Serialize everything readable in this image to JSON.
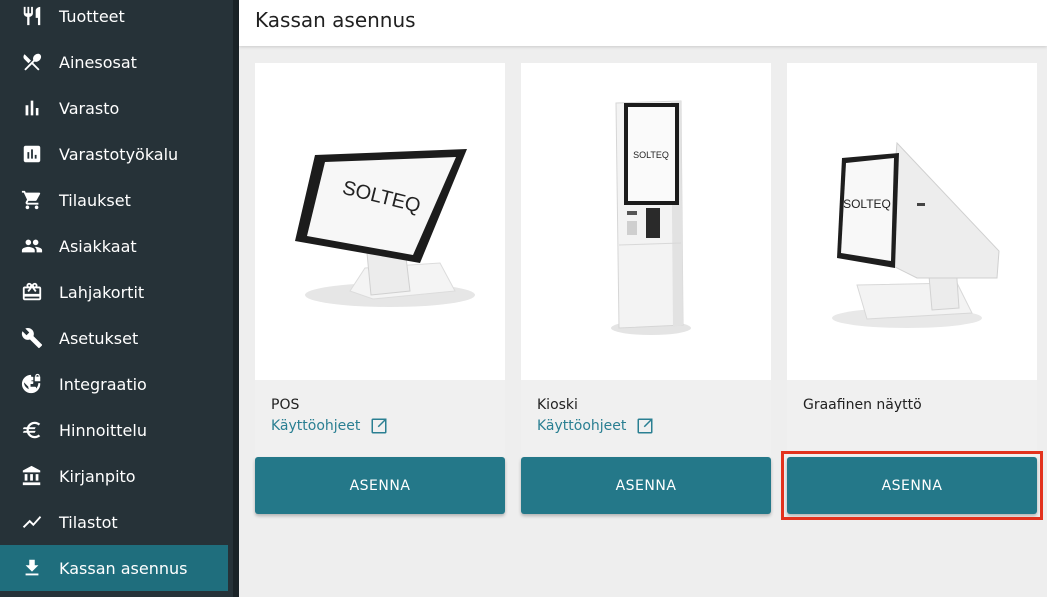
{
  "sidebar": {
    "items": [
      {
        "label": "Tuotteet",
        "icon": "cutlery-icon"
      },
      {
        "label": "Ainesosat",
        "icon": "utensils-cross-icon"
      },
      {
        "label": "Varasto",
        "icon": "bar-chart-icon"
      },
      {
        "label": "Varastotyökalu",
        "icon": "chart-box-icon"
      },
      {
        "label": "Tilaukset",
        "icon": "cart-icon"
      },
      {
        "label": "Asiakkaat",
        "icon": "people-icon"
      },
      {
        "label": "Lahjakortit",
        "icon": "gift-card-icon"
      },
      {
        "label": "Asetukset",
        "icon": "wrench-icon"
      },
      {
        "label": "Integraatio",
        "icon": "globe-lock-icon"
      },
      {
        "label": "Hinnoittelu",
        "icon": "euro-icon"
      },
      {
        "label": "Kirjanpito",
        "icon": "bank-icon"
      },
      {
        "label": "Tilastot",
        "icon": "trend-line-icon"
      },
      {
        "label": "Kassan asennus",
        "icon": "download-icon",
        "active": true
      }
    ]
  },
  "header": {
    "title": "Kassan asennus"
  },
  "cards": [
    {
      "title": "POS",
      "link": "Käyttöohjeet",
      "button": "ASENNA",
      "image_text": "SOLTEQ"
    },
    {
      "title": "Kioski",
      "link": "Käyttöohjeet",
      "button": "ASENNA",
      "image_text": "SOLTEQ"
    },
    {
      "title": "Graafinen näyttö",
      "button": "ASENNA",
      "image_text": "SOLTEQ"
    }
  ],
  "colors": {
    "sidebar": "#263238",
    "active": "#1f6e7d",
    "accent": "#247889",
    "link": "#2a7f92",
    "highlight": "#e3321d"
  }
}
